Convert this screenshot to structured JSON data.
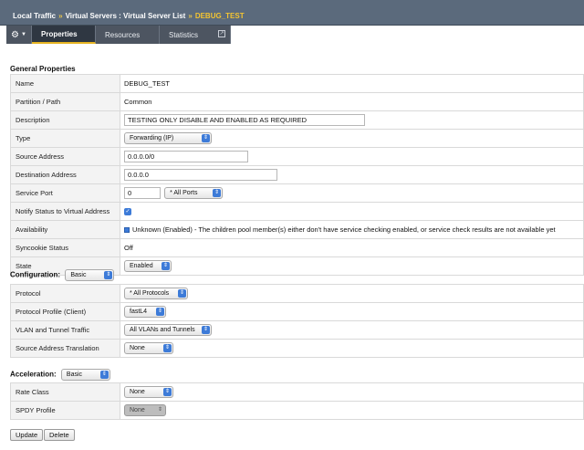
{
  "breadcrumb": {
    "items": [
      "Local Traffic",
      "Virtual Servers : Virtual Server List"
    ],
    "separator": "»",
    "current": "DEBUG_TEST"
  },
  "tabs": {
    "gear_icon": "gear-icon",
    "items": [
      "Properties",
      "Resources",
      "Statistics"
    ],
    "active": "Properties"
  },
  "general": {
    "title": "General Properties",
    "name_label": "Name",
    "name_value": "DEBUG_TEST",
    "partition_label": "Partition / Path",
    "partition_value": "Common",
    "description_label": "Description",
    "description_value": "TESTING ONLY DISABLE AND ENABLED AS REQUIRED",
    "type_label": "Type",
    "type_value": "Forwarding (IP)",
    "source_label": "Source Address",
    "source_value": "0.0.0.0/0",
    "destination_label": "Destination Address",
    "destination_value": "0.0.0.0",
    "port_label": "Service Port",
    "port_value": "0",
    "port_select": "* All Ports",
    "notify_label": "Notify Status to Virtual Address",
    "availability_label": "Availability",
    "availability_value": "Unknown (Enabled) - The children pool member(s) either don't have service checking enabled, or service check results are not available yet",
    "syncookie_label": "Syncookie Status",
    "syncookie_value": "Off",
    "state_label": "State",
    "state_value": "Enabled"
  },
  "configuration": {
    "title": "Configuration:",
    "mode": "Basic",
    "protocol_label": "Protocol",
    "protocol_value": "* All Protocols",
    "profile_label": "Protocol Profile (Client)",
    "profile_value": "fastL4",
    "vlan_label": "VLAN and Tunnel Traffic",
    "vlan_value": "All VLANs and Tunnels",
    "snat_label": "Source Address Translation",
    "snat_value": "None"
  },
  "acceleration": {
    "title": "Acceleration:",
    "mode": "Basic",
    "rate_label": "Rate Class",
    "rate_value": "None",
    "spdy_label": "SPDY Profile",
    "spdy_value": "None"
  },
  "actions": {
    "update": "Update",
    "delete": "Delete"
  },
  "colors": {
    "header": "#5b6a7c",
    "accent": "#f4c531",
    "select_arrow": "#3d7bd8"
  }
}
